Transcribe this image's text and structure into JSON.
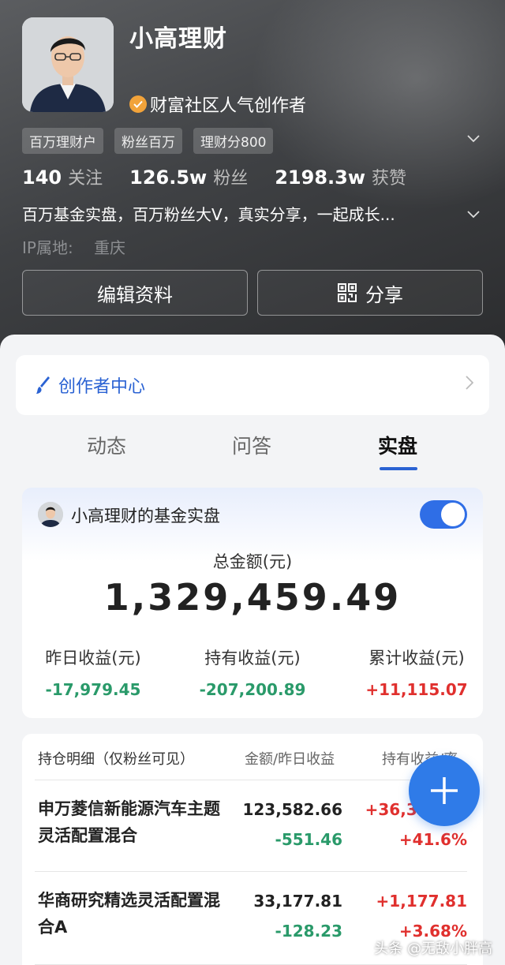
{
  "profile": {
    "username": "小高理财",
    "verified_text": "财富社区人气创作者",
    "tags": [
      "百万理财户",
      "粉丝百万",
      "理财分800"
    ],
    "stats": [
      {
        "value": "140",
        "label": "关注"
      },
      {
        "value": "126.5w",
        "label": "粉丝"
      },
      {
        "value": "2198.3w",
        "label": "获赞"
      }
    ],
    "bio": "百万基金实盘，百万粉丝大V，真实分享，一起成长...",
    "ip_label": "IP属地:",
    "ip_value": "重庆",
    "edit_button": "编辑资料",
    "share_button": "分享"
  },
  "creator_center": {
    "label": "创作者中心"
  },
  "tabs": [
    {
      "label": "动态",
      "active": false
    },
    {
      "label": "问答",
      "active": false
    },
    {
      "label": "实盘",
      "active": true
    }
  ],
  "portfolio": {
    "title": "小高理财的基金实盘",
    "toggle_on": true,
    "total_label": "总金额(元)",
    "total_value": "1,329,459.49",
    "metrics": [
      {
        "label": "昨日收益(元)",
        "value": "-17,979.45",
        "sign": "neg"
      },
      {
        "label": "持有收益(元)",
        "value": "-207,200.89",
        "sign": "neg"
      },
      {
        "label": "累计收益(元)",
        "value": "+11,115.07",
        "sign": "pos"
      }
    ]
  },
  "holdings": {
    "header": {
      "title": "持仓明细（仅粉丝可见）",
      "col2": "金额/昨日收益",
      "col3": "持有收益/率"
    },
    "rows": [
      {
        "name": "申万菱信新能源汽车主题灵活配置混合",
        "amount": "123,582.66",
        "day_gain": "-551.46",
        "hold_gain": "+36,303.98",
        "hold_rate": "+41.6%"
      },
      {
        "name": "华商研究精选灵活配置混合A",
        "amount": "33,177.81",
        "day_gain": "-128.23",
        "hold_gain": "+1,177.81",
        "hold_rate": "+3.68%"
      }
    ]
  },
  "watermark": "头条 @无敌小胖高",
  "colors": {
    "accent": "#2f6ee6",
    "gain": "#e0302e",
    "loss": "#2a9a6a"
  }
}
